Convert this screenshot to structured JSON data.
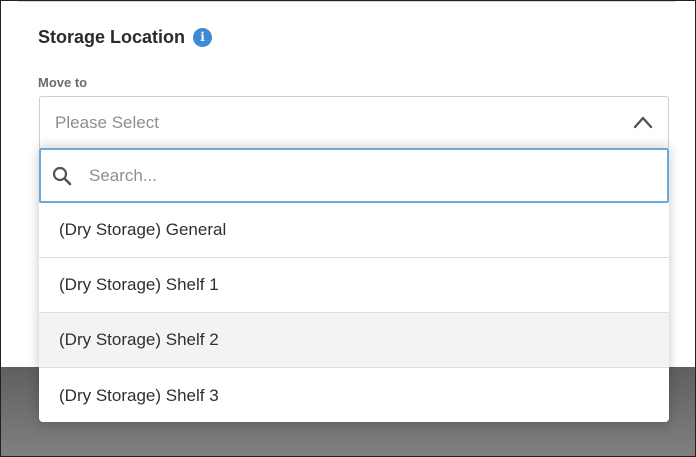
{
  "section": {
    "title": "Storage Location",
    "info_icon": "info-icon"
  },
  "field": {
    "label": "Move to",
    "placeholder": "Please Select",
    "expanded_icon": "chevron-up-icon"
  },
  "search": {
    "placeholder": "Search...",
    "value": "",
    "icon": "search-icon"
  },
  "options": [
    {
      "label": "(Dry Storage) General"
    },
    {
      "label": "(Dry Storage) Shelf 1"
    },
    {
      "label": "(Dry Storage) Shelf 2",
      "highlighted": true
    },
    {
      "label": "(Dry Storage) Shelf 3"
    }
  ],
  "colors": {
    "info_icon": "#3d8bd4",
    "search_focus_border": "#6da9d8",
    "highlight_row": "#f3f3f3"
  }
}
